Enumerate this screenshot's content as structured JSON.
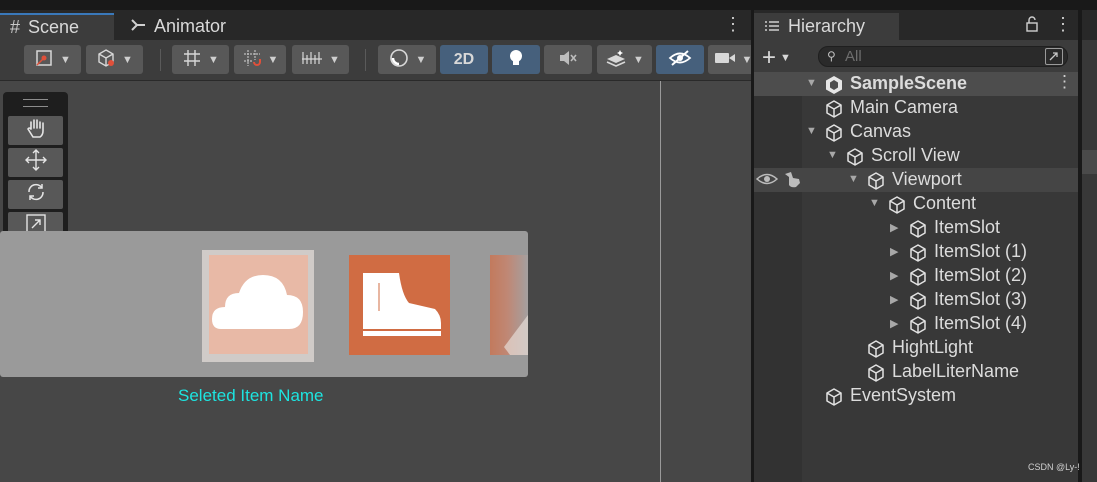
{
  "scene_panel": {
    "tabs": [
      {
        "label": "Scene",
        "icon": "hash-icon"
      },
      {
        "label": "Animator",
        "icon": "animator-icon"
      }
    ],
    "toolbar": {
      "buttons": [
        {
          "name": "draw-mode-button",
          "icon": "gizmo-icon",
          "dropdown": true
        },
        {
          "name": "shading-button",
          "icon": "cube-icon",
          "dropdown": true
        },
        {
          "name": "grid-button",
          "icon": "grid-icon",
          "dropdown": true
        },
        {
          "name": "snap-button",
          "icon": "snap-icon",
          "dropdown": true
        },
        {
          "name": "increment-button",
          "icon": "increment-icon",
          "dropdown": true
        },
        {
          "name": "render-mode-button",
          "icon": "sphere-icon",
          "dropdown": true
        },
        {
          "name": "2d-toggle",
          "label": "2D",
          "active": true
        },
        {
          "name": "lighting-toggle",
          "icon": "lightbulb-icon",
          "active": true
        },
        {
          "name": "audio-toggle",
          "icon": "speaker-muted-icon",
          "active": false
        },
        {
          "name": "effects-button",
          "icon": "effects-icon",
          "dropdown": true
        },
        {
          "name": "hidden-objects-toggle",
          "icon": "eye-slash-icon",
          "active": true
        },
        {
          "name": "camera-button",
          "icon": "camera-icon",
          "dropdown": true
        }
      ]
    },
    "tools": [
      {
        "name": "hand-tool",
        "icon": "hand-icon",
        "active": false
      },
      {
        "name": "move-tool",
        "icon": "move-icon",
        "active": false
      },
      {
        "name": "rotate-tool",
        "icon": "rotate-icon",
        "active": false
      },
      {
        "name": "scale-tool",
        "icon": "scale-icon",
        "active": false
      },
      {
        "name": "rect-tool",
        "icon": "rect-icon",
        "active": true
      },
      {
        "name": "transform-tool",
        "icon": "transform-icon",
        "active": false
      }
    ],
    "scroll_view_items": [
      {
        "icon": "cloud-icon",
        "color": "#e8b9a6",
        "selected": true
      },
      {
        "icon": "boot-icon",
        "color": "#d06c43",
        "selected": false
      },
      {
        "icon": "partial-item-icon",
        "color": "#c27a5d",
        "selected": false
      }
    ],
    "selected_item_name": "Seleted Item Name",
    "selected_item_color": "#1de4e0"
  },
  "hierarchy": {
    "tab_label": "Hierarchy",
    "search_placeholder": "All",
    "scene_name": "SampleScene",
    "items": [
      {
        "label": "Main Camera",
        "depth": 1,
        "arrow": "none"
      },
      {
        "label": "Canvas",
        "depth": 1,
        "arrow": "expanded"
      },
      {
        "label": "Scroll View",
        "depth": 2,
        "arrow": "expanded"
      },
      {
        "label": "Viewport",
        "depth": 3,
        "arrow": "expanded",
        "highlighted": true
      },
      {
        "label": "Content",
        "depth": 4,
        "arrow": "expanded"
      },
      {
        "label": "ItemSlot",
        "depth": 5,
        "arrow": "collapsed"
      },
      {
        "label": "ItemSlot (1)",
        "depth": 5,
        "arrow": "collapsed"
      },
      {
        "label": "ItemSlot (2)",
        "depth": 5,
        "arrow": "collapsed"
      },
      {
        "label": "ItemSlot (3)",
        "depth": 5,
        "arrow": "collapsed"
      },
      {
        "label": "ItemSlot (4)",
        "depth": 5,
        "arrow": "collapsed"
      },
      {
        "label": "HightLight",
        "depth": 3,
        "arrow": "none"
      },
      {
        "label": "LabelLiterName",
        "depth": 3,
        "arrow": "none"
      },
      {
        "label": "EventSystem",
        "depth": 1,
        "arrow": "none"
      }
    ]
  },
  "watermark": "CSDN @Ly-!",
  "colors": {
    "panel_bg": "#383838",
    "scene_bg": "#474747",
    "active_blue": "#46607c",
    "tab_accent": "#3a79bb"
  }
}
